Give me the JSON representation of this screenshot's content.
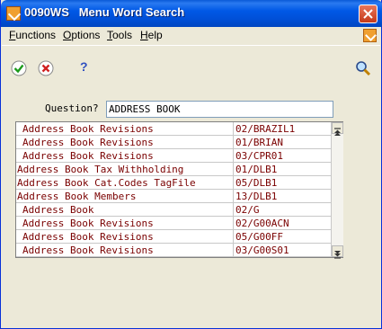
{
  "window": {
    "title": "0090WS   Menu Word Search"
  },
  "menu": [
    {
      "label": "Functions",
      "ul": "F",
      "rest": "unctions"
    },
    {
      "label": "Options",
      "ul": "O",
      "rest": "ptions"
    },
    {
      "label": "Tools",
      "ul": "T",
      "rest": "ools"
    },
    {
      "label": "Help",
      "ul": "H",
      "rest": "elp"
    }
  ],
  "toolbar": {
    "ok": "OK",
    "cancel": "Cancel",
    "help": "?"
  },
  "question": {
    "label": "Question?",
    "value": "ADDRESS BOOK"
  },
  "rows": [
    {
      "name": "Address Book Revisions",
      "code": "02/BRAZIL1",
      "indent": true
    },
    {
      "name": "Address Book Revisions",
      "code": "01/BRIAN",
      "indent": true
    },
    {
      "name": "Address Book Revisions",
      "code": "03/CPR01",
      "indent": true
    },
    {
      "name": "Address Book Tax Withholding",
      "code": "01/DLB1",
      "indent": false
    },
    {
      "name": "Address Book Cat.Codes TagFile",
      "code": "05/DLB1",
      "indent": false
    },
    {
      "name": "Address Book Members",
      "code": "13/DLB1",
      "indent": false
    },
    {
      "name": "Address Book",
      "code": "02/G",
      "indent": true
    },
    {
      "name": "Address Book Revisions",
      "code": "02/G00ACN",
      "indent": true
    },
    {
      "name": "Address Book Revisions",
      "code": "05/G00FF",
      "indent": true
    },
    {
      "name": "Address Book Revisions",
      "code": "03/G00S01",
      "indent": true
    }
  ]
}
